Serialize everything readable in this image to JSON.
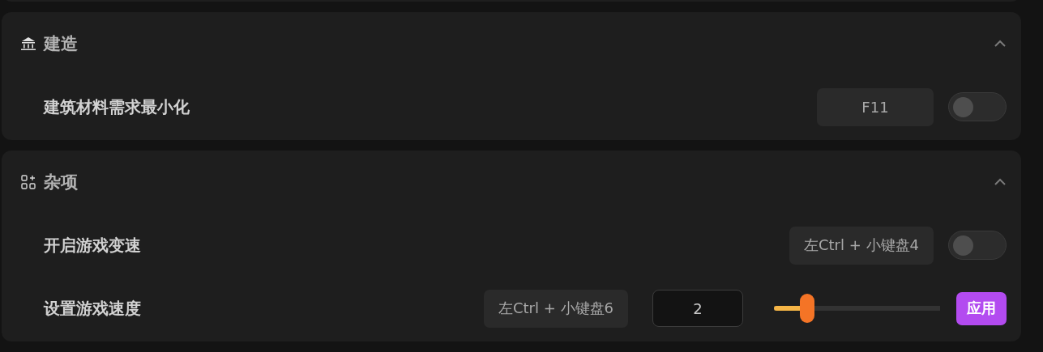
{
  "sections": [
    {
      "title": "建造",
      "kind": "building",
      "expanded": true,
      "rows": [
        {
          "kind": "toggle",
          "label": "建筑材料需求最小化",
          "hotkey": "F11",
          "on": false
        }
      ]
    },
    {
      "title": "杂项",
      "kind": "apps",
      "expanded": true,
      "rows": [
        {
          "kind": "toggle",
          "label": "开启游戏变速",
          "hotkey": "左Ctrl + 小键盘4",
          "on": false
        },
        {
          "kind": "slider",
          "label": "设置游戏速度",
          "hotkey": "左Ctrl + 小键盘6",
          "value": "2",
          "level": 0.2,
          "button": "应用"
        }
      ]
    }
  ]
}
